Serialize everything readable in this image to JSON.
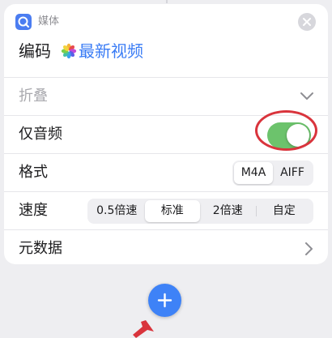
{
  "action": {
    "category": "媒体",
    "title": "编码",
    "variable": "最新视频"
  },
  "rows": {
    "collapse_label": "折叠",
    "audio_only_label": "仅音频",
    "audio_only_on": true,
    "format_label": "格式",
    "format_options": [
      "M4A",
      "AIFF"
    ],
    "format_selected": "M4A",
    "speed_label": "速度",
    "speed_options": [
      "0.5倍速",
      "标准",
      "2倍速",
      "自定"
    ],
    "speed_selected": "标准",
    "metadata_label": "元数据"
  },
  "icons": {
    "app": "media-app-icon",
    "close": "close-icon",
    "photos": "photos-icon",
    "chevron_down": "chevron-down-icon",
    "chevron_right": "chevron-right-icon",
    "add": "plus-icon"
  },
  "colors": {
    "accent": "#3a7cf5",
    "toggle_on": "#6cc36c",
    "annotation": "#d9343c"
  }
}
